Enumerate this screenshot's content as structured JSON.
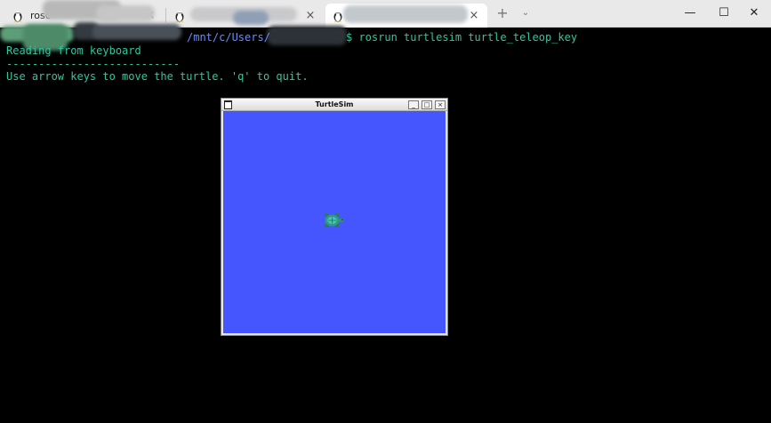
{
  "tabs": [
    {
      "label": "rosc",
      "close_icon": "×"
    },
    {
      "label": "",
      "close_icon": "×"
    },
    {
      "label": "",
      "close_icon": "×"
    }
  ],
  "tabbar": {
    "new_tab": "+",
    "dropdown": "⌄"
  },
  "window_controls": {
    "minimize": "—",
    "maximize": "☐",
    "close": "✕"
  },
  "terminal": {
    "prompt_path": "/mnt/c/Users/",
    "command": "$ rosrun turtlesim turtle_teleop_key",
    "line1": "Reading from keyboard",
    "line2": "---------------------------",
    "line3": "Use arrow keys to move the turtle. 'q' to quit."
  },
  "turtlesim": {
    "title": "TurtleSim",
    "btn_min": "_",
    "btn_max": "□",
    "btn_close": "×",
    "background_color": "#4556ff"
  }
}
